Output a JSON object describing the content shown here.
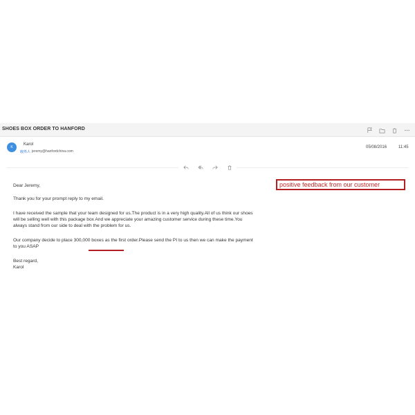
{
  "email": {
    "subject": "SHOES BOX ORDER TO HANFORD",
    "sender": {
      "avatar_initials": "K",
      "name": "Karol",
      "to_label": "收件人",
      "to_address": "jeremy@hanfordchina.com"
    },
    "date": "05/08/2016",
    "time": "11:45",
    "top_icons": [
      "flag-icon",
      "folder-icon",
      "trash-icon",
      "more-icon"
    ],
    "action_icons": [
      "reply-icon",
      "reply-all-icon",
      "forward-icon",
      "delete-icon"
    ],
    "body": {
      "greeting": "Dear Jeremy,",
      "thanks": "Thank you for your prompt reply to my email.",
      "sample": "I have received the sample that your team designed for us.The product is in a very high quality.All of us think our shoes will be selling well with this package box And we appreciate your amazing customer service during these time.You always stand from our side to deal with the problem for us.",
      "order": "Our company decide to place 300,000 boxes as the first order.Please send the PI to us then we can make the payment to you ASAP",
      "regards": "Best regard,",
      "signature": "Karol"
    }
  },
  "annotation": {
    "text": "positive feedback from our customer",
    "color": "#b41e1e"
  },
  "colors": {
    "avatar": "#3f8fe0",
    "link": "#2f7be0",
    "subject_bar": "#f4f4f4"
  }
}
